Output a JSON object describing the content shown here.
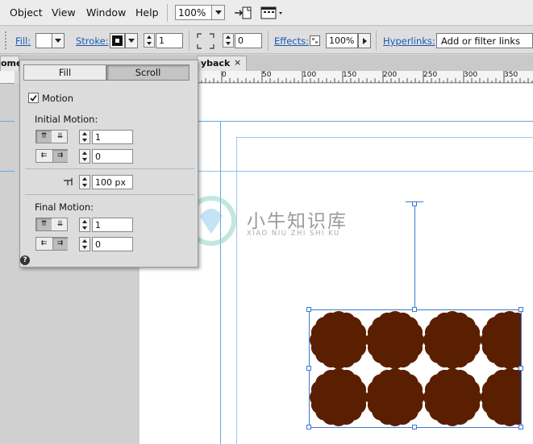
{
  "menu": {
    "items": [
      "Object",
      "View",
      "Window",
      "Help"
    ],
    "zoom_value": "100%"
  },
  "control_bar": {
    "fill_label": "Fill:",
    "stroke_label": "Stroke:",
    "stroke_width": "1",
    "corner_value": "0",
    "effects_label": "Effects:",
    "opacity_value": "100%",
    "hyperlinks_label": "Hyperlinks:",
    "hyperlinks_placeholder": "Add or filter links"
  },
  "tabs": {
    "left_tab_label": "ome",
    "doc_tab_label": "yback",
    "close_symbol": "×"
  },
  "ruler": {
    "ticks": [
      "0",
      "50",
      "100",
      "150",
      "200",
      "250",
      "300",
      "350"
    ]
  },
  "panel": {
    "tab_fill": "Fill",
    "tab_scroll": "Scroll",
    "active_tab": "Scroll",
    "motion_label": "Motion",
    "motion_checked": true,
    "initial_motion_label": "Initial Motion:",
    "initial_vertical_value": "1",
    "initial_horizontal_value": "0",
    "distance_value": "100 px",
    "final_motion_label": "Final Motion:",
    "final_vertical_value": "1",
    "final_horizontal_value": "0",
    "help_symbol": "?"
  },
  "watermark": {
    "chinese": "小牛知识库",
    "pinyin": "XIAO NIU ZHI SHI KU"
  },
  "colors": {
    "shape_fill": "#5a1e00",
    "selection": "#3a7ad4",
    "guide": "#5fa8e6",
    "link": "#1a59b5"
  }
}
